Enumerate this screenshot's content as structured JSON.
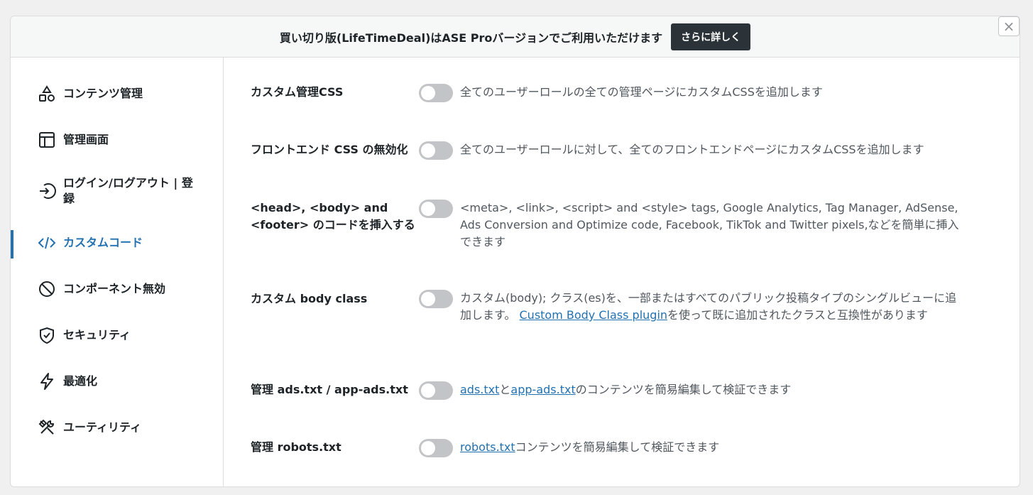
{
  "promo": {
    "text": "買い切り版(LifeTimeDeal)はASE Proバージョンでご利用いただけます",
    "button": "さらに詳しく"
  },
  "close_label": "×",
  "sidebar": {
    "items": [
      {
        "label": "コンテンツ管理",
        "icon": "content-management-icon"
      },
      {
        "label": "管理画面",
        "icon": "admin-interface-icon"
      },
      {
        "label": "ログイン/ログアウト | 登録",
        "icon": "login-logout-icon"
      },
      {
        "label": "カスタムコード",
        "icon": "code-icon",
        "active": true
      },
      {
        "label": "コンポーネント無効",
        "icon": "disable-components-icon"
      },
      {
        "label": "セキュリティ",
        "icon": "shield-icon"
      },
      {
        "label": "最適化",
        "icon": "lightning-icon"
      },
      {
        "label": "ユーティリティ",
        "icon": "tools-icon"
      }
    ]
  },
  "settings": [
    {
      "label": "カスタム管理CSS",
      "enabled": false,
      "desc": "全てのユーザーロールの全ての管理ページにカスタムCSSを追加します"
    },
    {
      "label": "フロントエンド CSS の無効化",
      "enabled": false,
      "desc": "全てのユーザーロールに対して、全てのフロントエンドページにカスタムCSSを追加します"
    },
    {
      "label": "<head>, <body> and <footer> のコードを挿入する",
      "enabled": false,
      "desc": "<meta>, <link>, <script> and <style> tags, Google Analytics, Tag Manager, AdSense, Ads Conversion and Optimize code, Facebook, TikTok and Twitter pixels,などを簡単に挿入できます"
    },
    {
      "label": "カスタム body class",
      "enabled": false,
      "desc_before": "カスタム(body); クラス(es)を、一部またはすべてのパブリック投稿タイプのシングルビューに追加します。 ",
      "desc_link": "Custom Body Class plugin",
      "desc_after": "を使って既に追加されたクラスと互換性があります"
    },
    {
      "label": "管理 ads.txt / app-ads.txt",
      "enabled": false,
      "desc_link1": "ads.txt",
      "desc_mid": "と",
      "desc_link2": "app-ads.txt",
      "desc_after": "のコンテンツを簡易編集して検証できます"
    },
    {
      "label": "管理 robots.txt",
      "enabled": false,
      "desc_link": "robots.txt",
      "desc_after": "コンテンツを簡易編集して検証できます"
    }
  ]
}
